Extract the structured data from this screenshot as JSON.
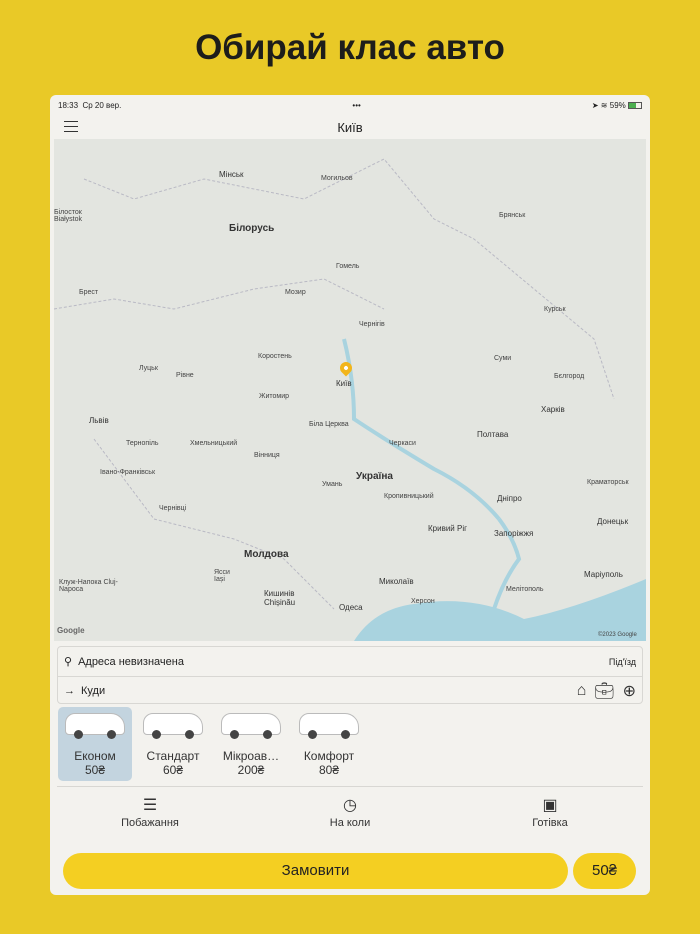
{
  "headline": "Обирай клас авто",
  "status": {
    "time": "18:33",
    "date": "Ср 20 вер.",
    "battery": "59%"
  },
  "nav": {
    "title": "Київ"
  },
  "map": {
    "labels": {
      "minsk": "Мінськ",
      "belarus": "Білорусь",
      "kyiv": "Київ",
      "ukraine": "Україна",
      "moldova": "Молдова",
      "lviv": "Львів",
      "kharkiv": "Харків",
      "poltava": "Полтава",
      "dnipro": "Дніпро",
      "zaporizhzhia": "Запоріжжя",
      "odesa": "Одеса",
      "mykolaiv": "Миколаїв",
      "kryvyi_rih": "Кривий Ріг",
      "chisinau": "Кишинів Chișinău",
      "donetsk": "Донецьк",
      "mariupol": "Маріуполь",
      "zhytomyr": "Житомир",
      "vinnytsia": "Вінниця",
      "chernihiv": "Чернігів",
      "sumy": "Суми",
      "gomel": "Гомель",
      "rivne": "Рівне",
      "lutsk": "Луцьк",
      "brest": "Брест",
      "kursk": "Курськ",
      "bryansk": "Брянськ",
      "kherson": "Херсон",
      "iasi": "Ясси Iași",
      "bila_tserkva": "Біла Церква",
      "cherkasy": "Черкаси",
      "kropyvnytskyi": "Кропивницький",
      "uman": "Умань",
      "ternopil": "Тернопіль",
      "khmelnytskyi": "Хмельницький",
      "mozyr": "Мозир",
      "korosten": "Коростень",
      "bialystok": "Білосток Białystok",
      "belgorod": "Бєлгород",
      "mogilev": "Могильов",
      "kramatorsk": "Краматорськ",
      "melitopol": "Мелітополь",
      "chernivtsi": "Чернівці",
      "ivano_frankivsk": "Івано-Франківськ",
      "cluj": "Клуж-Напока Cluj-Napoca"
    },
    "google": "Google",
    "copyright": "©2023 Google"
  },
  "address": {
    "from": "Адреса невизначена",
    "entrance": "Під'їзд",
    "to": "Куди"
  },
  "cars": [
    {
      "name": "Економ",
      "price": "50₴"
    },
    {
      "name": "Стандарт",
      "price": "60₴"
    },
    {
      "name": "Мікроав…",
      "price": "200₴"
    },
    {
      "name": "Комфорт",
      "price": "80₴"
    }
  ],
  "options": [
    {
      "label": "Побажання"
    },
    {
      "label": "На коли"
    },
    {
      "label": "Готівка"
    }
  ],
  "order": {
    "label": "Замовити",
    "price": "50₴"
  }
}
